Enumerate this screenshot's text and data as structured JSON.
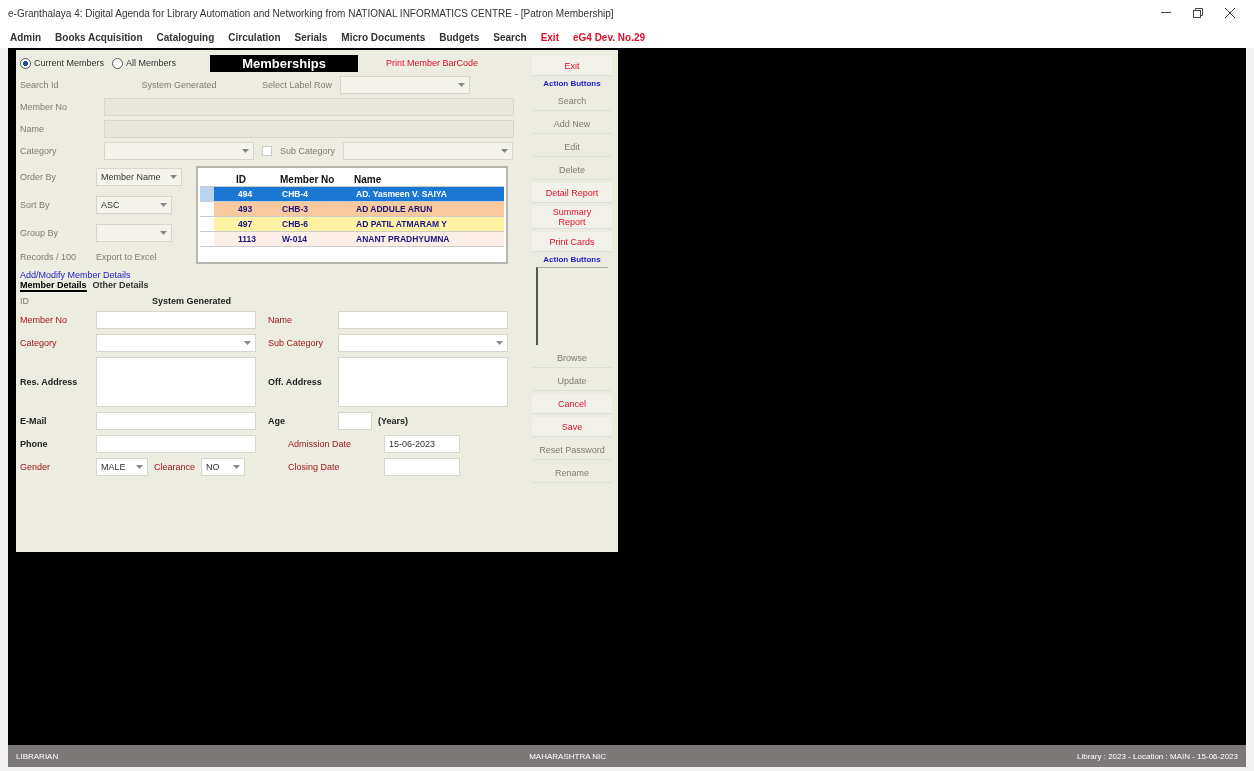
{
  "window": {
    "title": "e-Granthalaya 4: Digital Agenda for Library Automation and Networking from NATIONAL INFORMATICS CENTRE - [Patron Membership]"
  },
  "menu": [
    {
      "label": "Admin",
      "kind": "normal"
    },
    {
      "label": "Books Acquisition",
      "kind": "normal"
    },
    {
      "label": "Cataloguing",
      "kind": "normal"
    },
    {
      "label": "Circulation",
      "kind": "normal"
    },
    {
      "label": "Serials",
      "kind": "normal"
    },
    {
      "label": "Micro Documents",
      "kind": "normal"
    },
    {
      "label": "Budgets",
      "kind": "normal"
    },
    {
      "label": "Search",
      "kind": "normal"
    },
    {
      "label": "Exit",
      "kind": "alert"
    },
    {
      "label": "eG4 Dev. No.29",
      "kind": "alert"
    }
  ],
  "search": {
    "filters": [
      {
        "label": "Current Members",
        "selected": true
      },
      {
        "label": "All Members",
        "selected": false
      }
    ],
    "heading": "Memberships",
    "barcode_link": "Print Member BarCode",
    "id_label": "Search Id",
    "id_value": "System Generated",
    "label_row_label": "Select Label Row",
    "member_no_label": "Member No",
    "name_label": "Name",
    "category_label": "Category",
    "sub_category": {
      "label": "Sub Category",
      "checked": false
    },
    "order_by": {
      "label": "Order By",
      "value": "Member Name"
    },
    "sort_by": {
      "label": "Sort By",
      "value": "ASC"
    },
    "group_by": {
      "label": "Group By"
    },
    "records": {
      "label": "Records / 100",
      "button": "Export to Excel"
    }
  },
  "grid": {
    "columns": [
      "ID",
      "Member No",
      "Name"
    ],
    "rows": [
      {
        "id": "494",
        "member_no": "CHB-4",
        "name": "AD. Yasmeen V. SAIYA",
        "color": "#1a78d4",
        "selected": true
      },
      {
        "id": "493",
        "member_no": "CHB-3",
        "name": "AD ADDULE ARUN",
        "color": "#f8c99c",
        "selected": false
      },
      {
        "id": "497",
        "member_no": "CHB-6",
        "name": "AD PATIL ATMARAM Y",
        "color": "#fff3a6",
        "selected": false
      },
      {
        "id": "1113",
        "member_no": "W-014",
        "name": "ANANT PRADHYUMNA",
        "color": "#fbefe8",
        "selected": false
      }
    ]
  },
  "actions": [
    {
      "label": "Exit",
      "kind": "button",
      "enabled": true
    },
    {
      "label": "Action Buttons",
      "kind": "heading"
    },
    {
      "label": "Search",
      "kind": "button",
      "enabled": false
    },
    {
      "label": "Add New",
      "kind": "button",
      "enabled": false
    },
    {
      "label": "Edit",
      "kind": "button",
      "enabled": false
    },
    {
      "label": "Delete",
      "kind": "button",
      "enabled": false
    },
    {
      "label": "Detail Report",
      "kind": "button",
      "enabled": true
    },
    {
      "label": "Summary Report",
      "kind": "button",
      "enabled": true
    },
    {
      "label": "Print Cards",
      "kind": "button",
      "enabled": true
    },
    {
      "label": "Action Buttons",
      "kind": "heading"
    },
    {
      "kind": "listbox"
    },
    {
      "label": "Browse",
      "kind": "button",
      "enabled": false
    },
    {
      "label": "Update",
      "kind": "button",
      "enabled": false
    },
    {
      "label": "Cancel",
      "kind": "button",
      "enabled": true
    },
    {
      "label": "Save",
      "kind": "button",
      "enabled": true
    },
    {
      "label": "Reset Password",
      "kind": "button",
      "enabled": false
    },
    {
      "label": "Rename",
      "kind": "button",
      "enabled": false
    }
  ],
  "form": {
    "title": "Add/Modify Member Details",
    "tabs": [
      {
        "label": "Member Details",
        "selected": true
      },
      {
        "label": "Other Details",
        "selected": false
      }
    ],
    "id_label": "ID",
    "id_value": "System Generated",
    "member_no": "Member No",
    "name": "Name",
    "category": "Category",
    "sub_category": "Sub Category",
    "res_address": "Res. Address",
    "off_address": "Off. Address",
    "email": "E-Mail",
    "age": "Age",
    "age_unit": "(Years)",
    "phone": "Phone",
    "admission_date": {
      "label": "Admission Date",
      "value": "15-06-2023"
    },
    "closing_date": "Closing Date",
    "gender": {
      "label": "Gender",
      "value": "MALE"
    },
    "clearance": {
      "label": "Clearance",
      "value": "NO"
    }
  },
  "status_bar": {
    "user": "LIBRARIAN",
    "center": "MAHARASHTRA NIC",
    "right": "Library : 2023 - Location : MAIN - 15-06-2023"
  }
}
